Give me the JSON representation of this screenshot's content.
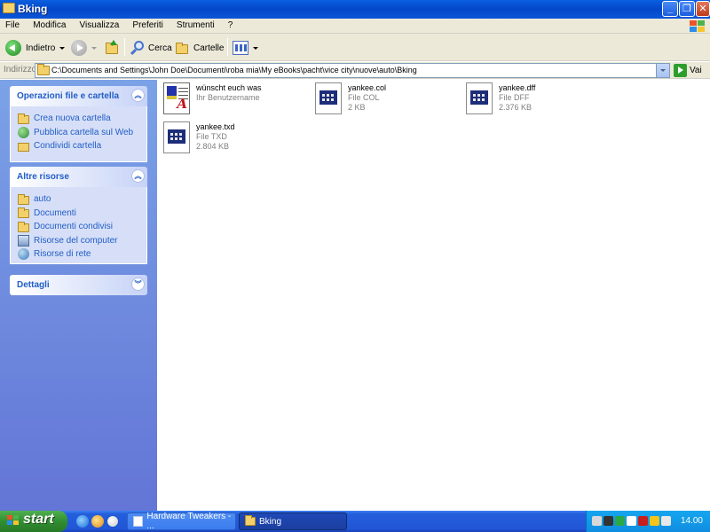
{
  "window": {
    "title": "Bking",
    "minimize_label": "_",
    "maximize_label": "❐",
    "close_label": "✕"
  },
  "menu": [
    "File",
    "Modifica",
    "Visualizza",
    "Preferiti",
    "Strumenti",
    "?"
  ],
  "toolbar": {
    "back_label": "Indietro",
    "search_label": "Cerca",
    "folders_label": "Cartelle"
  },
  "address": {
    "label": "Indirizzo",
    "value": "C:\\Documents and Settings\\John Doe\\Documenti\\roba mia\\My eBooks\\pacht\\vice city\\nuove\\auto\\Bking",
    "go_label": "Vai"
  },
  "sidebar": {
    "tasks": {
      "title": "Operazioni file e cartella",
      "items": [
        {
          "label": "Crea nuova cartella",
          "icon": "new-folder-icon"
        },
        {
          "label": "Pubblica cartella sul Web",
          "icon": "globe-icon"
        },
        {
          "label": "Condividi cartella",
          "icon": "share-folder-icon"
        }
      ]
    },
    "places": {
      "title": "Altre risorse",
      "items": [
        {
          "label": "auto",
          "icon": "folder-icon"
        },
        {
          "label": "Documenti",
          "icon": "folder-icon"
        },
        {
          "label": "Documenti condivisi",
          "icon": "folder-icon"
        },
        {
          "label": "Risorse del computer",
          "icon": "computer-icon"
        },
        {
          "label": "Risorse di rete",
          "icon": "network-icon"
        }
      ]
    },
    "details": {
      "title": "Dettagli"
    }
  },
  "files": [
    {
      "name": "wünscht euch was",
      "sub1": "Ihr Benutzername",
      "sub2": "",
      "icon": "text-document-icon"
    },
    {
      "name": "yankee.col",
      "sub1": "File COL",
      "sub2": "2 KB",
      "icon": "generic-file-icon"
    },
    {
      "name": "yankee.dff",
      "sub1": "File DFF",
      "sub2": "2.376 KB",
      "icon": "generic-file-icon"
    },
    {
      "name": "yankee.txd",
      "sub1": "File TXD",
      "sub2": "2.804 KB",
      "icon": "generic-file-icon"
    }
  ],
  "taskbar": {
    "start_label": "start",
    "buttons": [
      {
        "label": "Hardware Tweakers - ...",
        "active": false
      },
      {
        "label": "Bking",
        "active": true
      }
    ],
    "clock": "14.00"
  },
  "colors": {
    "titlebar": "#0346c9",
    "sidebar_link": "#215dc6",
    "taskbar": "#2156d7",
    "start": "#318d31"
  }
}
